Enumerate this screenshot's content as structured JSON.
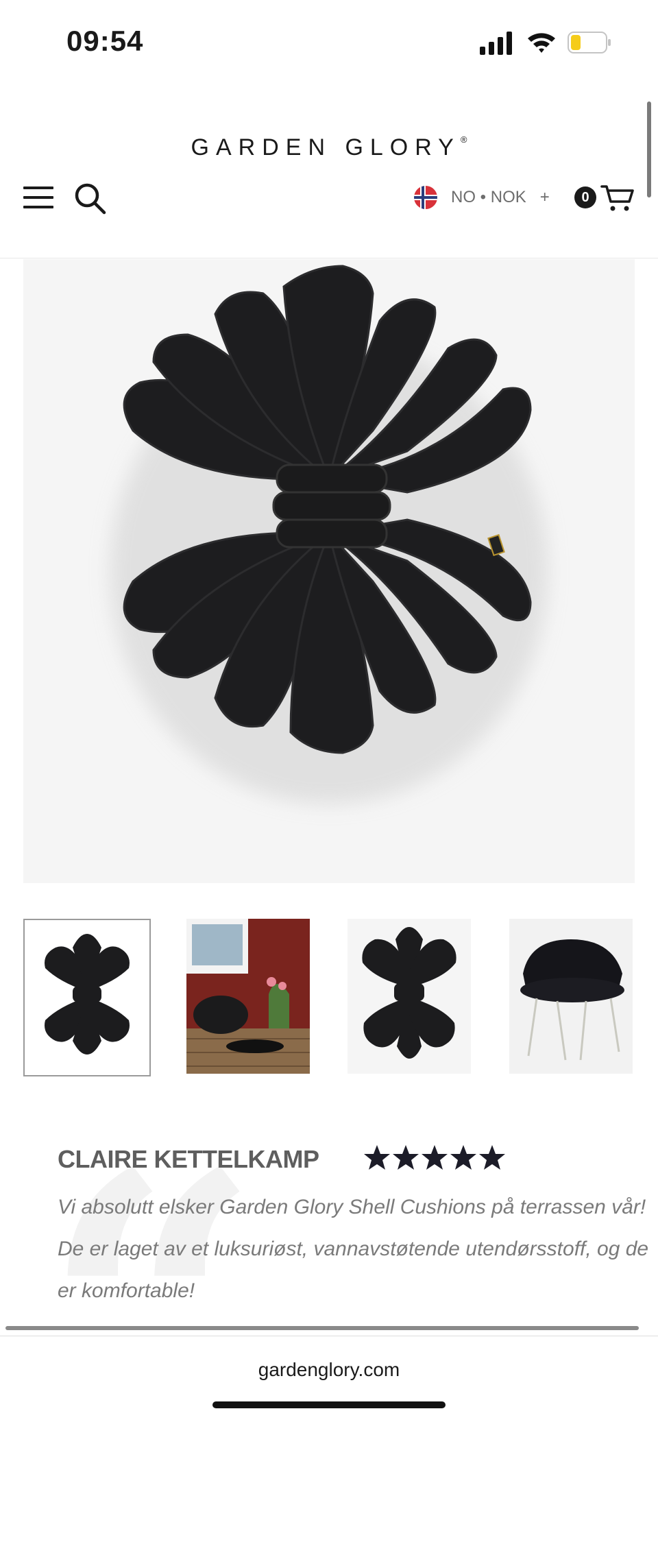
{
  "status_bar": {
    "time": "09:54"
  },
  "header": {
    "brand": "GARDEN GLORY",
    "brand_mark": "®",
    "locale": "NO • NOK",
    "locale_toggle": "+",
    "cart_count": "0"
  },
  "review": {
    "name": "CLAIRE KETTELKAMP",
    "rating": 5,
    "text": "Vi absolutt elsker Garden Glory Shell Cushions på terrassen vår! De er laget av et luksuriøst, vannavstøtende utendørsstoff, og de er komfortable!"
  },
  "browser": {
    "url": "gardenglory.com"
  },
  "icons": {
    "menu": "hamburger-icon",
    "search": "search-icon",
    "flag": "norway-flag-icon",
    "cart": "cart-icon",
    "star": "star-icon"
  },
  "colors": {
    "product": "#1b1b1c",
    "star": "#1c1c28",
    "review_name": "#5e5e5e"
  }
}
